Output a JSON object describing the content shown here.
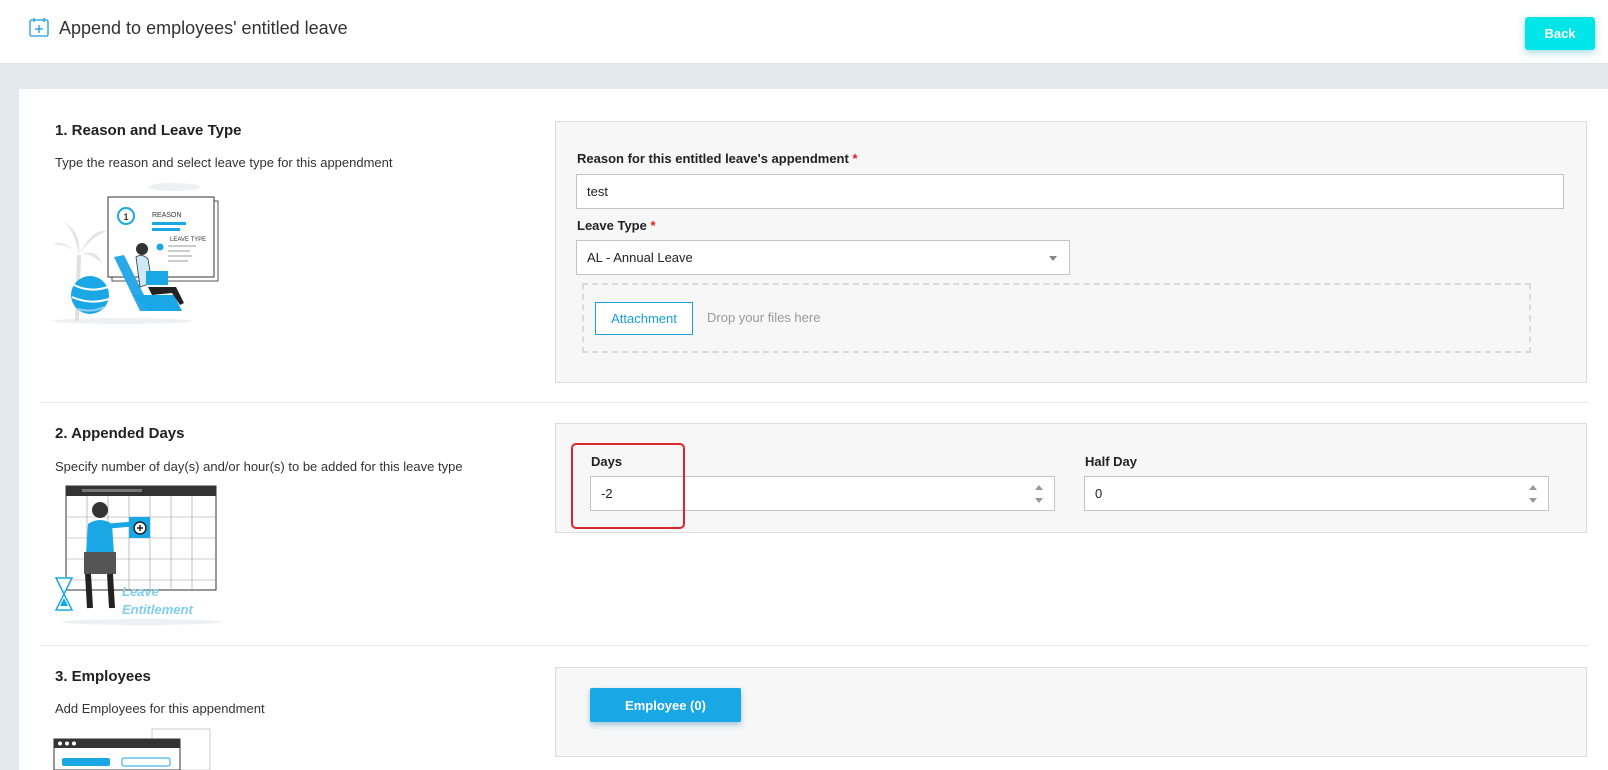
{
  "header": {
    "title": "Append to employees' entitled leave",
    "back_label": "Back"
  },
  "section1": {
    "title": "1. Reason and Leave Type",
    "description": "Type the reason and select leave type for this appendment",
    "illustration_text_1": "REASON",
    "illustration_text_2": "LEAVE TYPE",
    "illustration_badge": "1",
    "reason_label": "Reason for this entitled leave's appendment",
    "reason_value": "test",
    "leave_type_label": "Leave Type",
    "leave_type_value": "AL - Annual Leave",
    "required_mark": "*",
    "attachment_label": "Attachment",
    "drop_text": "Drop your files here"
  },
  "section2": {
    "title": "2. Appended Days",
    "description": "Specify number of day(s) and/or hour(s) to be added for this leave type",
    "illustration_text_1": "Leave",
    "illustration_text_2": "Entitlement",
    "days_label": "Days",
    "days_value": "-2",
    "half_day_label": "Half Day",
    "half_day_value": "0"
  },
  "section3": {
    "title": "3. Employees",
    "description": "Add Employees for this appendment",
    "employee_button_label": "Employee (0)"
  },
  "colors": {
    "accent": "#1aa7e6",
    "back_button": "#00e5e8",
    "required": "#d9261c",
    "highlight_border": "#d9262f"
  },
  "icons": {
    "title_icon": "calendar-plus-icon",
    "select_arrow": "chevron-down-icon",
    "spin_arrows": "stepper-arrows-icon"
  }
}
